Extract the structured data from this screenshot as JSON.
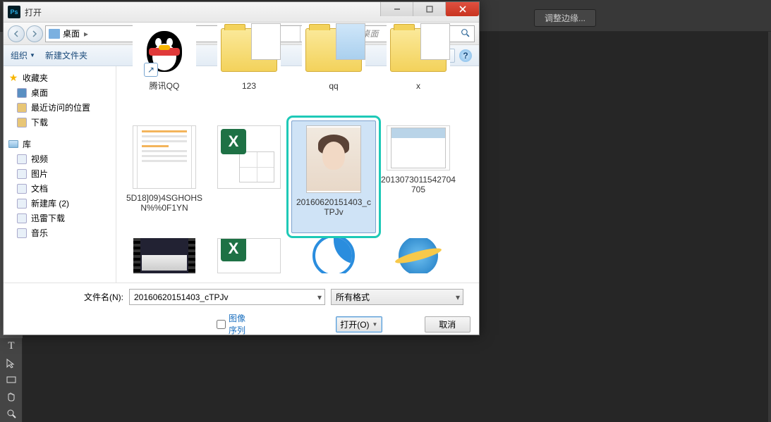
{
  "ps": {
    "edge_button": "调整边缘..."
  },
  "dialog": {
    "title": "打开",
    "breadcrumb": {
      "location": "桌面"
    },
    "search": {
      "placeholder": "搜索 桌面"
    },
    "toolbar": {
      "organize": "组织",
      "new_folder": "新建文件夹"
    },
    "sidebar": {
      "favorites": {
        "label": "收藏夹",
        "items": [
          "桌面",
          "最近访问的位置",
          "下载"
        ]
      },
      "libraries": {
        "label": "库",
        "items": [
          "视频",
          "图片",
          "文档",
          "新建库 (2)",
          "迅雷下载",
          "音乐"
        ]
      }
    },
    "files": {
      "row1": [
        {
          "name": "腾讯QQ"
        },
        {
          "name": "123"
        },
        {
          "name": "qq"
        },
        {
          "name": "x"
        }
      ],
      "row2": [
        {
          "name": "5D18]09)4SGHOHSN%%0F1YN"
        },
        {
          "name": ""
        },
        {
          "name": "20160620151403_cTPJv"
        },
        {
          "name": "2013073011542704705"
        }
      ],
      "row3": [
        {
          "name": ""
        },
        {
          "name": ""
        },
        {
          "name": ""
        },
        {
          "name": ""
        }
      ]
    },
    "filename_label": "文件名(N):",
    "filename_value": "20160620151403_cTPJv",
    "filter_value": "所有格式",
    "sequence_checkbox": "图像序列",
    "open_btn": "打开(O)",
    "cancel_btn": "取消"
  }
}
